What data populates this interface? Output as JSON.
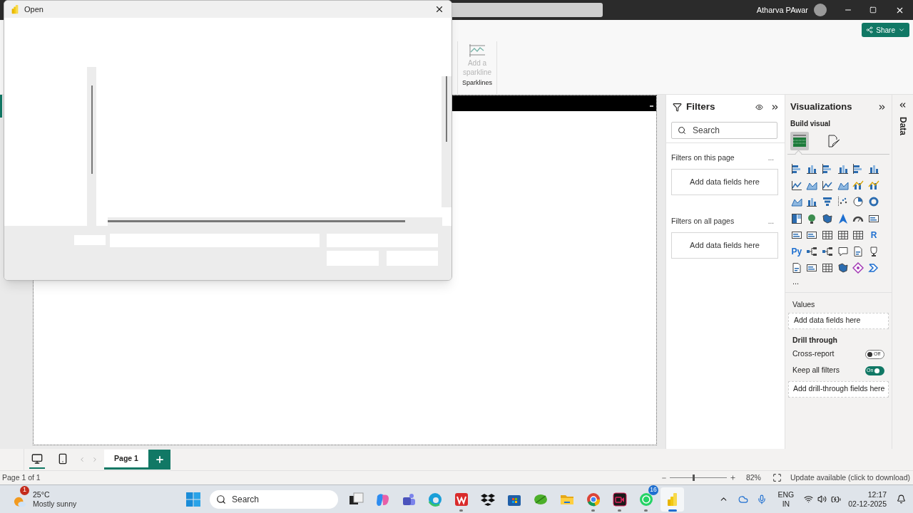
{
  "title_bar": {
    "user": "Atharva PAwar"
  },
  "ribbon": {
    "sparkline": {
      "label": "Add a sparkline",
      "disabled": true
    },
    "group": "Sparklines",
    "share": "Share"
  },
  "dialog": {
    "title": "Open"
  },
  "filters": {
    "title": "Filters",
    "search": {
      "placeholder": "Search"
    },
    "sections": [
      {
        "title": "Filters on this page",
        "more": "...",
        "drop": "Add data fields here"
      },
      {
        "title": "Filters on all pages",
        "more": "...",
        "drop": "Add data fields here"
      }
    ]
  },
  "visualizations": {
    "title": "Visualizations",
    "build": "Build visual",
    "modes": [
      {
        "selected": true
      },
      {
        "selected": false
      }
    ],
    "text_icons": [
      "R",
      "Py"
    ],
    "more": "...",
    "values": {
      "title": "Values",
      "drop": "Add data fields here"
    },
    "drill": {
      "title": "Drill through",
      "toggles": [
        {
          "label": "Cross-report",
          "on": false,
          "state_text": "Off"
        },
        {
          "label": "Keep all filters",
          "on": true,
          "state_text": "On"
        }
      ],
      "drop": "Add drill-through fields here"
    }
  },
  "data_pane": {
    "title": "Data"
  },
  "views": [
    {
      "kind": "desktop",
      "selected": true
    },
    {
      "kind": "phone",
      "selected": false
    }
  ],
  "pages": [
    {
      "label": "Page 1",
      "selected": true
    }
  ],
  "status_bar": {
    "page": "Page 1 of 1",
    "zoom": "82%",
    "level": 0.4,
    "update": "Update available (click to download)"
  },
  "taskbar": {
    "weather": {
      "badge": "1",
      "temp": "25°C",
      "text": "Mostly sunny"
    },
    "search": {
      "placeholder": "Search"
    },
    "apps": [
      {
        "kind": "taskview",
        "running": false,
        "selected": false
      },
      {
        "kind": "copilot",
        "running": false,
        "selected": false
      },
      {
        "kind": "teams",
        "running": false,
        "selected": false
      },
      {
        "kind": "edge",
        "running": false,
        "selected": false
      },
      {
        "kind": "wps",
        "running": true,
        "selected": false
      },
      {
        "kind": "dropbox",
        "running": false,
        "selected": false
      },
      {
        "kind": "store",
        "running": false,
        "selected": false
      },
      {
        "kind": "leaf",
        "running": false,
        "selected": false
      },
      {
        "kind": "folder",
        "running": false,
        "selected": false
      },
      {
        "kind": "chrome",
        "running": true,
        "selected": false
      },
      {
        "kind": "recorder",
        "running": true,
        "selected": false
      },
      {
        "kind": "whatsapp",
        "running": true,
        "selected": false,
        "badge": "16"
      },
      {
        "kind": "powerbi",
        "running": true,
        "selected": true
      }
    ],
    "lang": [
      "ENG",
      "IN"
    ],
    "time": "12:17",
    "date": "02-12-2025"
  }
}
